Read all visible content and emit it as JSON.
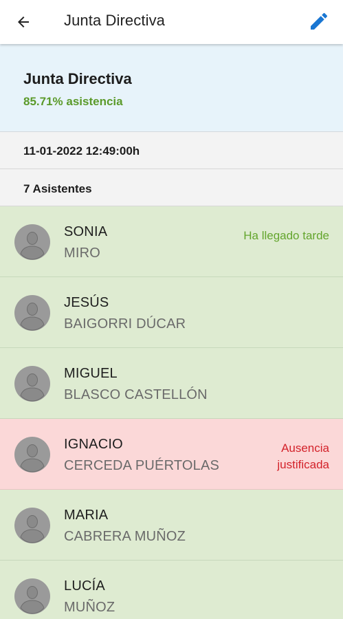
{
  "appbar": {
    "back_icon": "arrow-back-icon",
    "title": "Junta Directiva",
    "edit_icon": "pencil-edit-icon"
  },
  "summary": {
    "title": "Junta Directiva",
    "attendance": "85.71% asistencia"
  },
  "meeting": {
    "datetime": "11-01-2022 12:49:00h",
    "attendees_count": "7 Asistentes"
  },
  "colors": {
    "primary": "#1976d2",
    "summary_bg": "#e7f3fa",
    "present_bg": "#deebd1",
    "absent_bg": "#fbd8d8",
    "late_text": "#63a52d",
    "justified_text": "#d3222a",
    "attendance_text": "#5b9a2a"
  },
  "attendees": [
    {
      "first": "SONIA",
      "last": "MIRO",
      "state": "present",
      "status": "Ha llegado tarde",
      "status_type": "late"
    },
    {
      "first": "JESÚS",
      "last": "BAIGORRI DÚCAR",
      "state": "present",
      "status": "",
      "status_type": ""
    },
    {
      "first": "MIGUEL",
      "last": "BLASCO CASTELLÓN",
      "state": "present",
      "status": "",
      "status_type": ""
    },
    {
      "first": "IGNACIO",
      "last": "CERCEDA PUÉRTOLAS",
      "state": "absent",
      "status": "Ausencia justificada",
      "status_type": "justified"
    },
    {
      "first": "MARIA",
      "last": "CABRERA MUÑOZ",
      "state": "present",
      "status": "",
      "status_type": ""
    },
    {
      "first": "LUCÍA",
      "last": "MUÑOZ",
      "state": "present",
      "status": "",
      "status_type": ""
    }
  ]
}
